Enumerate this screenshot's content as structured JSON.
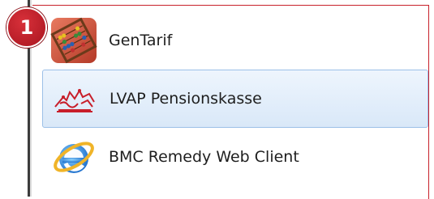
{
  "callout": {
    "number": "1",
    "color": "#c8202a"
  },
  "menu": {
    "items": [
      {
        "label": "GenTarif",
        "icon": "abacus-icon",
        "selected": false
      },
      {
        "label": "LVAP Pensionskasse",
        "icon": "pensionskasse-logo-icon",
        "selected": true
      },
      {
        "label": "BMC Remedy Web Client",
        "icon": "internet-explorer-icon",
        "selected": false
      }
    ]
  },
  "colors": {
    "selection": "#d9e8f8",
    "selection_border": "#9cc0e8"
  }
}
